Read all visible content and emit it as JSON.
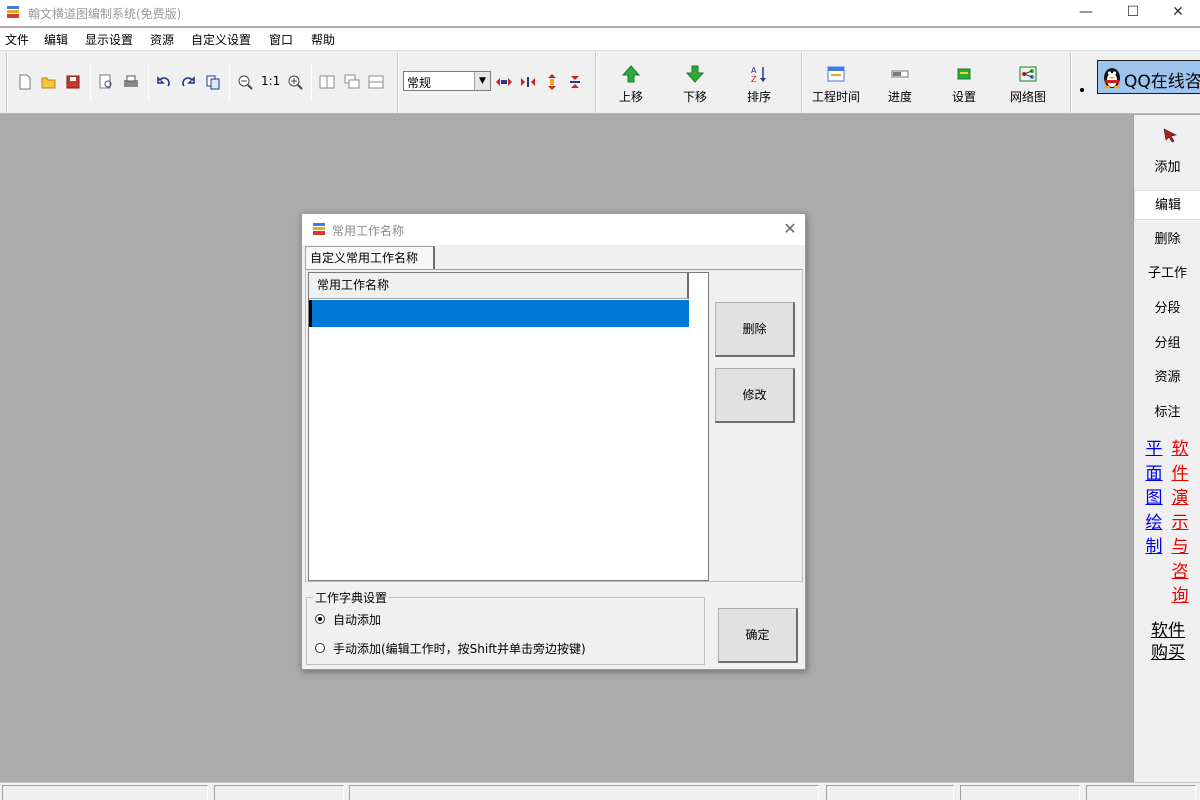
{
  "window": {
    "title": "翰文横道图编制系统(免费版)",
    "minimize": "—",
    "maximize": "☐",
    "close": "✕"
  },
  "menu": [
    "文件",
    "编辑",
    "显示设置",
    "资源",
    "自定义设置",
    "窗口",
    "帮助"
  ],
  "toolbar": {
    "zoom_label": "1:1",
    "style_select": "常规",
    "buttons": {
      "move_up": "上移",
      "move_down": "下移",
      "sort": "排序",
      "duration": "工程时间",
      "progress": "进度",
      "settings": "设置",
      "network": "网络图"
    },
    "qq": "QQ在线咨询"
  },
  "sidebar": {
    "items": [
      "添加",
      "编辑",
      "删除",
      "子工作",
      "分段",
      "分组",
      "资源",
      "标注"
    ],
    "active": "编辑",
    "link_plan": "平面图绘制",
    "link_demo": "软件演示与咨询",
    "link_buy_1": "软件",
    "link_buy_2": "购买",
    "colors": {
      "plan": "#0000ee",
      "demo": "#ee0000"
    }
  },
  "dialog": {
    "title": "常用工作名称",
    "close": "✕",
    "tab": "自定义常用工作名称",
    "list_header": "常用工作名称",
    "delete_btn": "删除",
    "modify_btn": "修改",
    "group_title": "工作字典设置",
    "radio_auto": "自动添加",
    "radio_manual": "手动添加(编辑工作时，按Shift并单击旁边按键)",
    "ok_btn": "确定",
    "selected_color": "#0078d7"
  }
}
